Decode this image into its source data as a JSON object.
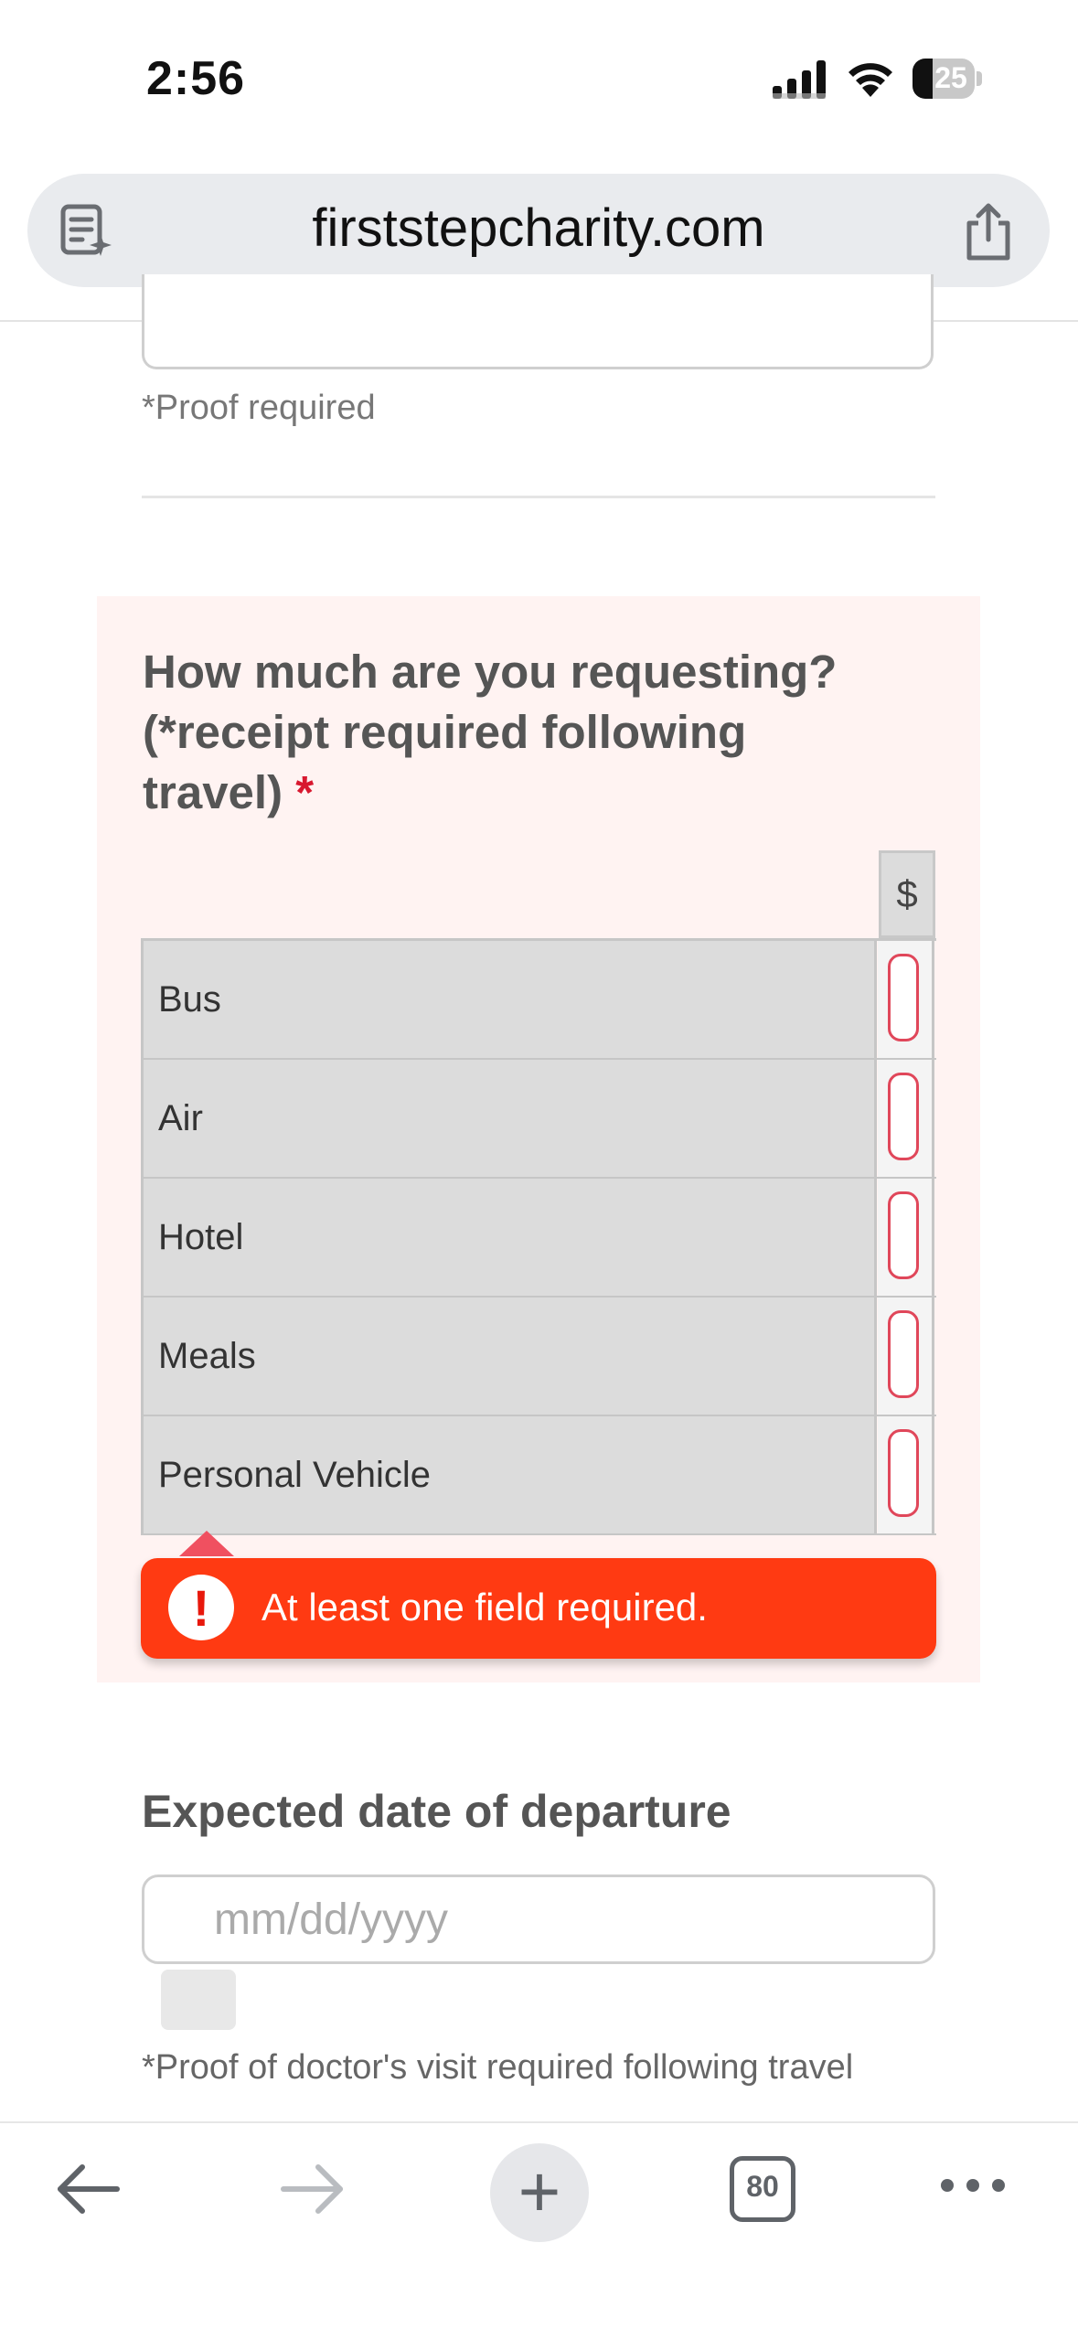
{
  "status_bar": {
    "time": "2:56",
    "battery_level": "25"
  },
  "browser": {
    "url": "firststepcharity.com"
  },
  "form": {
    "proof_note": "*Proof required",
    "question": "How much are you requesting? (*receipt required following travel)",
    "required_marker": "*",
    "column_header": "$",
    "rows": [
      {
        "label": "Bus"
      },
      {
        "label": "Air"
      },
      {
        "label": "Hotel"
      },
      {
        "label": "Meals"
      },
      {
        "label": "Personal Vehicle"
      }
    ],
    "error_message": "At least one field required.",
    "error_icon": "!",
    "departure_label": "Expected date of departure",
    "date_placeholder": "mm/dd/yyyy",
    "doctor_note": "*Proof of doctor's visit required following travel"
  },
  "toolbar": {
    "tab_count": "80",
    "new_tab_glyph": "+"
  },
  "colors": {
    "error": "#ff3a12",
    "required": "#d8182f",
    "invalid_border": "#e0475a",
    "panel_bg": "#fff3f2"
  }
}
